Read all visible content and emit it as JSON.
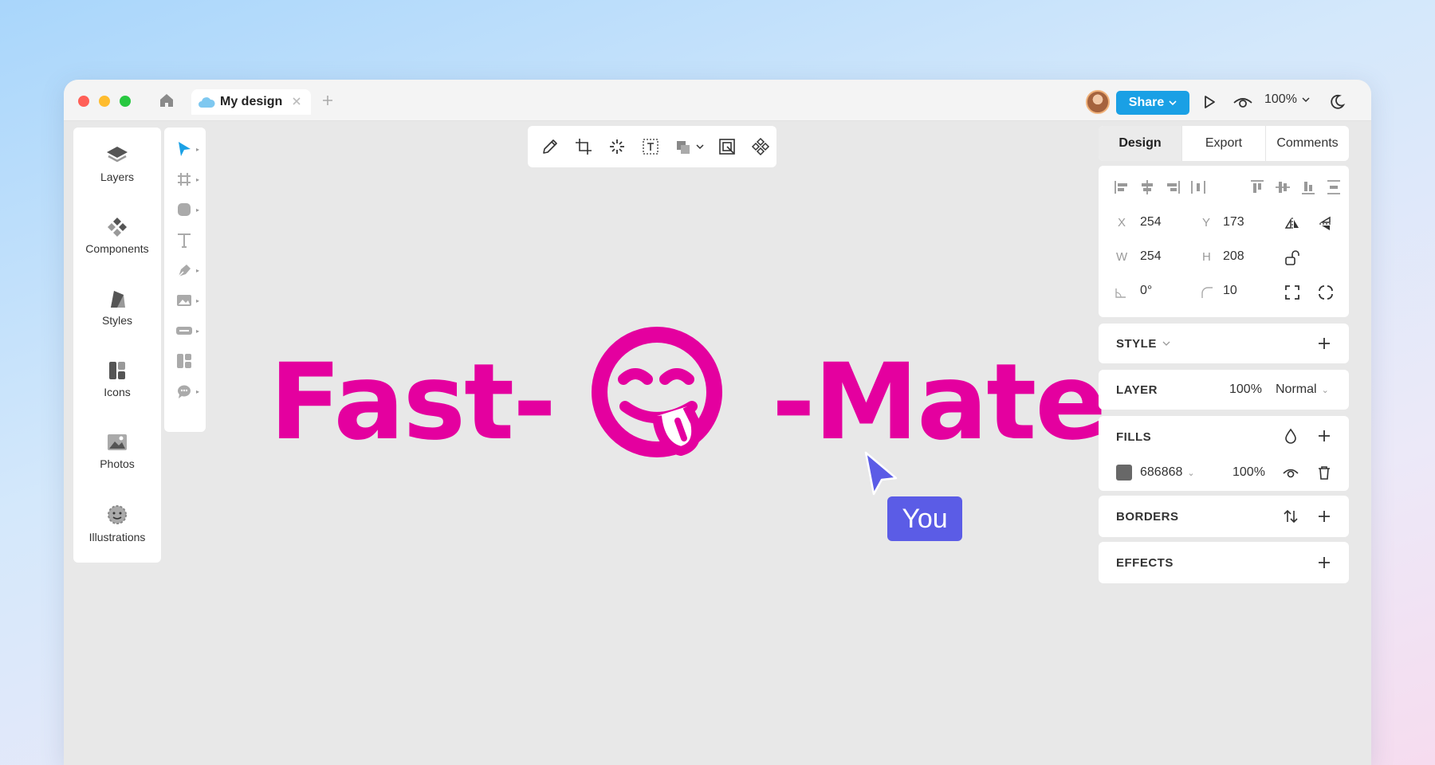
{
  "window": {
    "tab_title": "My design",
    "share_label": "Share",
    "zoom": "100%"
  },
  "left_panel": {
    "items": [
      {
        "label": "Layers",
        "icon": "layers-icon"
      },
      {
        "label": "Components",
        "icon": "components-icon"
      },
      {
        "label": "Styles",
        "icon": "styles-icon"
      },
      {
        "label": "Icons",
        "icon": "icons-icon"
      },
      {
        "label": "Photos",
        "icon": "photos-icon"
      },
      {
        "label": "Illustrations",
        "icon": "illustrations-icon"
      }
    ]
  },
  "tools": [
    "move-tool",
    "frame-tool",
    "shape-tool",
    "text-tool",
    "pen-tool",
    "image-tool",
    "button-tool",
    "components-tool",
    "comment-tool"
  ],
  "top_toolbar": [
    "pencil-icon",
    "crop-icon",
    "magic-icon",
    "text-frame-icon",
    "boolean-icon",
    "frame-select-icon",
    "component-icon"
  ],
  "canvas": {
    "logo_left": "Fast-",
    "logo_right": "-Mate",
    "logo_color": "#e4009f",
    "cursor_label": "You",
    "cursor_color": "#5b5ce6"
  },
  "right_panel": {
    "tabs": [
      "Design",
      "Export",
      "Comments"
    ],
    "active_tab": "Design",
    "props": {
      "x_label": "X",
      "x": "254",
      "y_label": "Y",
      "y": "173",
      "w_label": "W",
      "w": "254",
      "h_label": "H",
      "h": "208",
      "rotation": "0°",
      "radius": "10"
    },
    "style_title": "STYLE",
    "layer_title": "LAYER",
    "layer_opacity": "100%",
    "layer_blend": "Normal",
    "fills_title": "FILLS",
    "fill_hex": "686868",
    "fill_opacity": "100%",
    "borders_title": "BORDERS",
    "effects_title": "EFFECTS"
  }
}
